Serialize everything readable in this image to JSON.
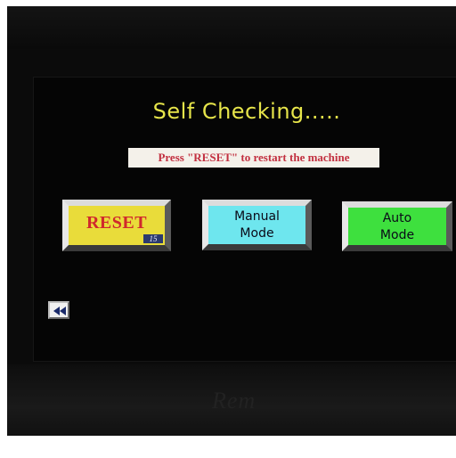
{
  "screen": {
    "title": "Self Checking.....",
    "message": "Press \"RESET\" to restart the machine"
  },
  "buttons": {
    "reset": {
      "label": "RESET",
      "counter": "15"
    },
    "manual": {
      "line1": "Manual",
      "line2": "Mode"
    },
    "auto": {
      "line1": "Auto",
      "line2": "Mode"
    }
  },
  "icons": {
    "back": "rewind-icon"
  },
  "colors": {
    "title": "#e6e44a",
    "message_text": "#c23040",
    "reset_bg": "#e9dc3a",
    "reset_text": "#d0282c",
    "manual_bg": "#6ee6ee",
    "auto_bg": "#3ee03e",
    "screen_bg": "#050505"
  }
}
